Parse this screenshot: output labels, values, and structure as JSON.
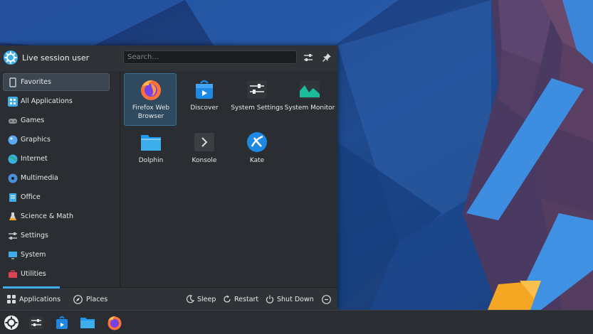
{
  "launcher": {
    "user_name": "Live session user",
    "search_placeholder": "Search...",
    "header_icons": [
      "configure-icon",
      "pin-icon"
    ],
    "categories": [
      {
        "label": "Favorites",
        "icon": "bookmark-icon",
        "selected": true
      },
      {
        "label": "All Applications",
        "icon": "grid-icon"
      },
      {
        "label": "Games",
        "icon": "gamepad-icon"
      },
      {
        "label": "Graphics",
        "icon": "palette-icon"
      },
      {
        "label": "Internet",
        "icon": "globe-icon"
      },
      {
        "label": "Multimedia",
        "icon": "media-icon"
      },
      {
        "label": "Office",
        "icon": "document-icon"
      },
      {
        "label": "Science & Math",
        "icon": "flask-icon"
      },
      {
        "label": "Settings",
        "icon": "settings-icon"
      },
      {
        "label": "System",
        "icon": "monitor-icon"
      },
      {
        "label": "Utilities",
        "icon": "toolbox-icon"
      }
    ],
    "apps": [
      {
        "label": "Firefox Web Browser",
        "icon": "firefox-icon",
        "selected": true
      },
      {
        "label": "Discover",
        "icon": "discover-icon"
      },
      {
        "label": "System Settings",
        "icon": "system-settings-icon"
      },
      {
        "label": "System Monitor",
        "icon": "system-monitor-icon"
      },
      {
        "label": "Dolphin",
        "icon": "folder-icon"
      },
      {
        "label": "Konsole",
        "icon": "terminal-icon"
      },
      {
        "label": "Kate",
        "icon": "kate-icon"
      }
    ],
    "footer": {
      "applications_label": "Applications",
      "places_label": "Places",
      "sleep_label": "Sleep",
      "restart_label": "Restart",
      "shutdown_label": "Shut Down"
    }
  },
  "taskbar": {
    "items": [
      "kde-launcher-icon",
      "system-settings-icon",
      "discover-icon",
      "folder-icon",
      "firefox-icon"
    ]
  },
  "colors": {
    "accent": "#3daee9",
    "panel": "#2a2e32",
    "wallpaper_blue": "#1d3f86",
    "wallpaper_orange": "#f5a623"
  }
}
